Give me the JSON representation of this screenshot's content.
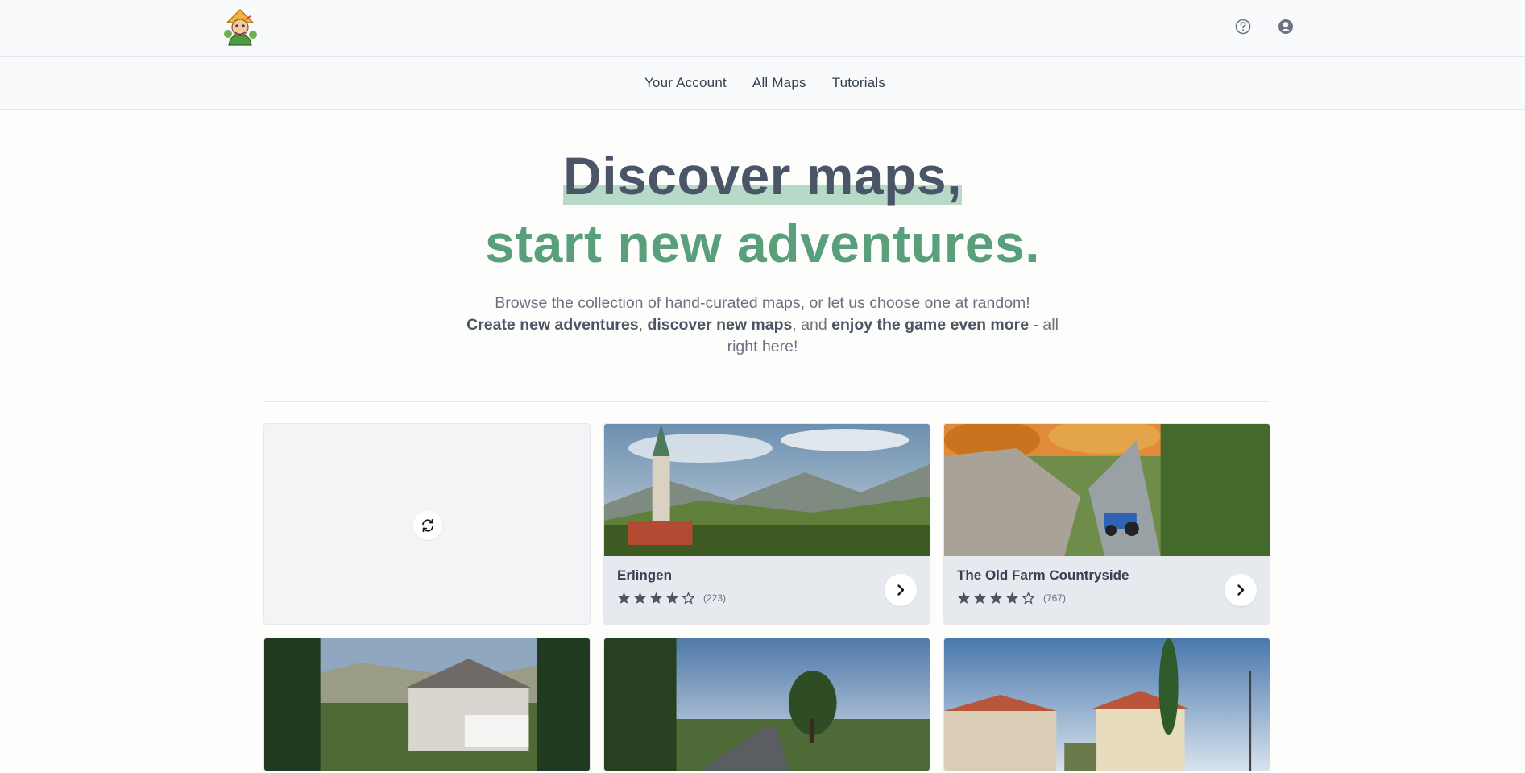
{
  "nav": {
    "items": [
      {
        "label": "Your Account"
      },
      {
        "label": "All Maps"
      },
      {
        "label": "Tutorials"
      }
    ]
  },
  "hero": {
    "headline_line1": "Discover maps,",
    "headline_line2": "start new adventures.",
    "sub_line1": "Browse the collection of hand-curated maps, or let us choose one at random!",
    "sub_bold1": "Create new adventures",
    "sub_sep1": ", ",
    "sub_bold2": "discover new maps",
    "sub_sep2": ", and ",
    "sub_bold3": "enjoy the game even more",
    "sub_tail": " - all right here!"
  },
  "maps": [
    {
      "title": "Erlingen",
      "rating": 4,
      "max_rating": 5,
      "count": "(223)"
    },
    {
      "title": "The Old Farm Countryside",
      "rating": 4,
      "max_rating": 5,
      "count": "(767)"
    }
  ],
  "colors": {
    "accent_green": "#5a9f7c",
    "highlight": "#b7dac8",
    "heading": "#4a5568"
  },
  "icons": {
    "help": "question-circle-icon",
    "account": "user-circle-icon",
    "refresh": "refresh-icon",
    "go": "chevron-right-icon"
  }
}
